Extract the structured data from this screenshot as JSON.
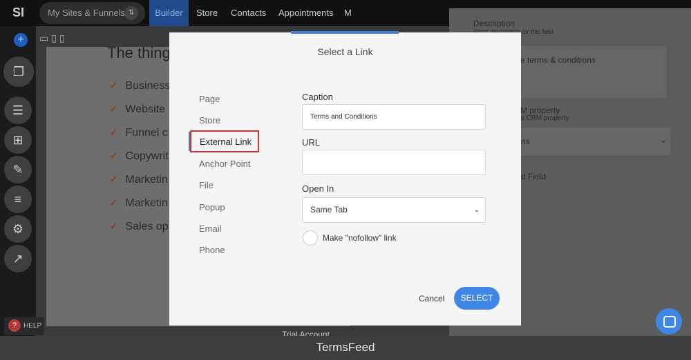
{
  "topnav": {
    "logo": "SI",
    "sites_label": "My Sites & Funnels",
    "tabs": [
      "Builder",
      "Store",
      "Contacts",
      "Appointments",
      "M"
    ]
  },
  "canvas": {
    "heading": "The thing",
    "features": [
      "Business",
      "Website",
      "Funnel c",
      "Copywrit",
      "Marketin",
      "Marketin",
      "Sales op"
    ]
  },
  "help_label": "HELP",
  "right_panel": {
    "description_title": "Description",
    "description_sub": "Short description for this field",
    "terms_text": "e terms & conditions",
    "crm_title": "M property",
    "crm_sub": "a CRM property",
    "select_value": "ns",
    "field_text": "d Field"
  },
  "trial_label": "Trial Account",
  "modal": {
    "title": "Select a Link",
    "nav": [
      "Page",
      "Store",
      "External Link",
      "Anchor Point",
      "File",
      "Popup",
      "Email",
      "Phone"
    ],
    "caption_label": "Caption",
    "caption_value": "Terms and Conditions",
    "url_label": "URL",
    "url_value": "",
    "open_in_label": "Open In",
    "open_in_value": "Same Tab",
    "nofollow_label": "Make \"nofollow\" link",
    "cancel_label": "Cancel",
    "select_label": "SELECT"
  },
  "footer_caption": "TermsFeed"
}
